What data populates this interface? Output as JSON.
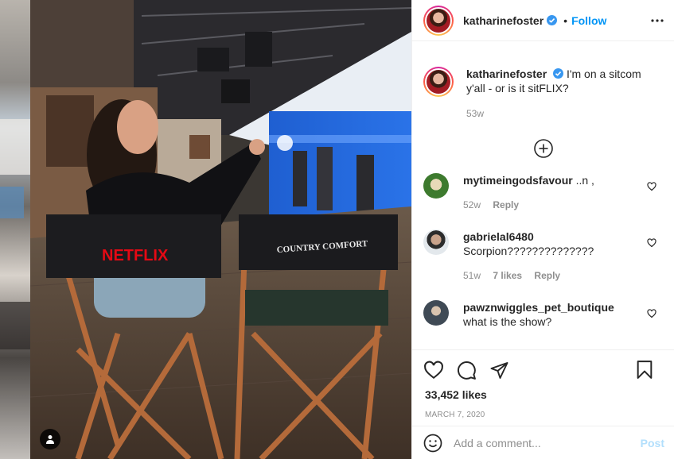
{
  "post": {
    "author": "katharinefoster",
    "verified": true,
    "follow_label": "Follow",
    "separator": "•",
    "photo": {
      "chair_left_text": "NETFLIX",
      "chair_right_text": "COUNTRY COMFORT"
    }
  },
  "caption": {
    "username": "katharinefoster",
    "text": "I'm on a sitcom y'all - or is it sitFLIX?",
    "age": "53w"
  },
  "comments": [
    {
      "username": "mytimeingodsfavour",
      "text": "..n ,",
      "age": "52w",
      "likes": "",
      "reply": "Reply",
      "avatar_color": "#6aa84f"
    },
    {
      "username": "gabrielal6480",
      "text": "Scorpion??????????????",
      "age": "51w",
      "likes": "7 likes",
      "reply": "Reply",
      "avatar_color": "#7f8c8d"
    },
    {
      "username": "pawznwiggles_pet_boutique",
      "text": "what is the show?",
      "age": "",
      "likes": "",
      "reply": "",
      "avatar_color": "#5d6d7e"
    }
  ],
  "actions": {
    "likes": "33,452 likes",
    "date": "MARCH 7, 2020"
  },
  "composer": {
    "placeholder": "Add a comment...",
    "post_label": "Post"
  },
  "colors": {
    "accent": "#0095f6",
    "post_disabled": "#b2dffc",
    "muted": "#8e8e8e",
    "netflix_red": "#e50914"
  },
  "icons": {
    "more": "more-horizontal-icon",
    "load_more": "plus-circle-icon",
    "heart": "heart-icon",
    "comment": "comment-icon",
    "share": "paper-plane-icon",
    "save": "bookmark-icon",
    "emoji": "emoji-icon",
    "tag": "user-tag-icon",
    "verified": "verified-badge-icon"
  }
}
